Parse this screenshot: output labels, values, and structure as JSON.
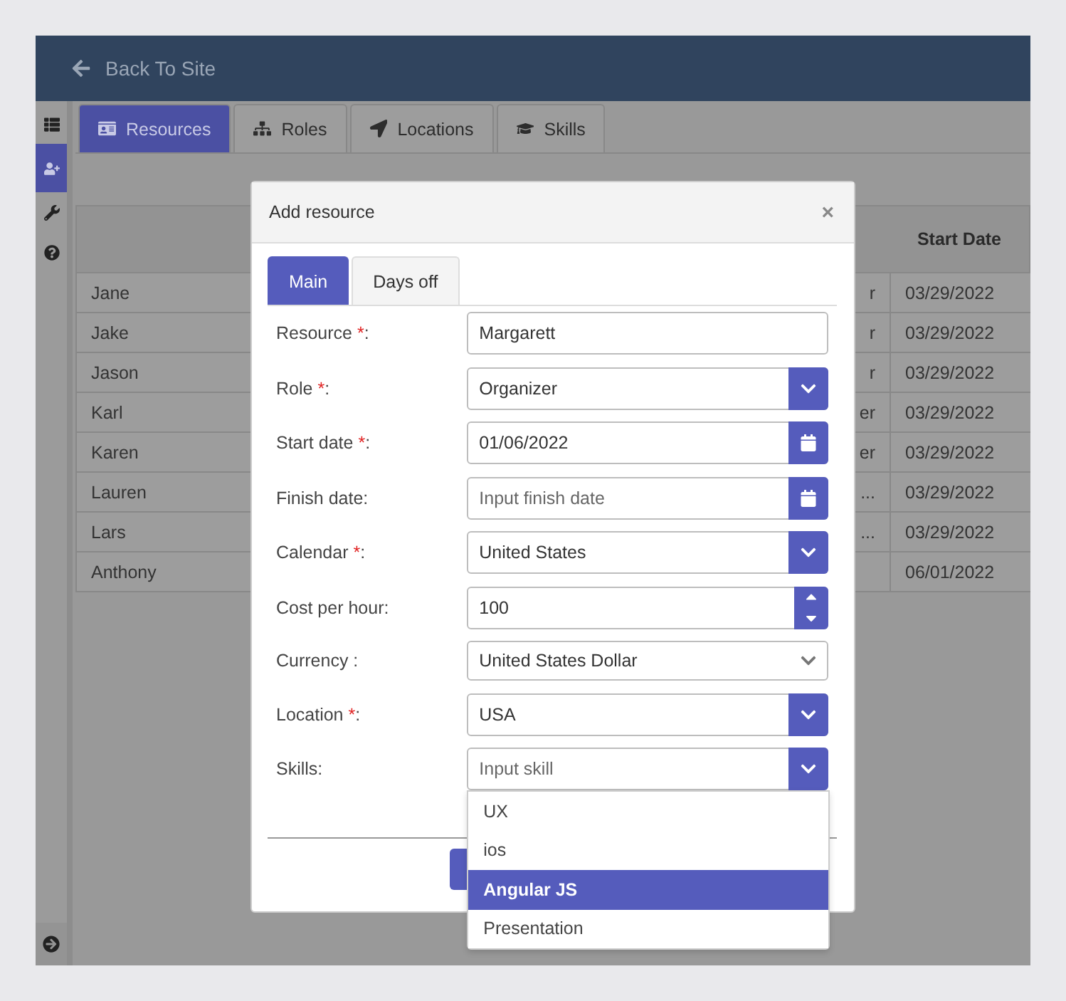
{
  "header": {
    "back_label": "Back To Site"
  },
  "sidebar": {
    "items": [
      {
        "kind": "list",
        "selected": false
      },
      {
        "kind": "user-add",
        "selected": true
      },
      {
        "kind": "wrench",
        "selected": false
      },
      {
        "kind": "help",
        "selected": false
      }
    ]
  },
  "tabs": [
    {
      "label": "Resources",
      "kind": "id-card",
      "selected": true
    },
    {
      "label": "Roles",
      "kind": "sitemap",
      "selected": false
    },
    {
      "label": "Locations",
      "kind": "arrow",
      "selected": false
    },
    {
      "label": "Skills",
      "kind": "cap",
      "selected": false
    }
  ],
  "table": {
    "start_date_heading": "Start Date",
    "rows": [
      {
        "name": "Jane",
        "column_2": "r",
        "start_date": "03/29/2022"
      },
      {
        "name": "Jake",
        "column_2": "r",
        "start_date": "03/29/2022"
      },
      {
        "name": "Jason",
        "column_2": "r",
        "start_date": "03/29/2022"
      },
      {
        "name": "Karl",
        "column_2": "er",
        "start_date": "03/29/2022"
      },
      {
        "name": "Karen",
        "column_2": "er",
        "start_date": "03/29/2022"
      },
      {
        "name": "Lauren",
        "column_2": "...",
        "start_date": "03/29/2022"
      },
      {
        "name": "Lars",
        "column_2": "...",
        "start_date": "03/29/2022"
      },
      {
        "name": "Anthony",
        "start_date": "06/01/2022"
      }
    ]
  },
  "modal": {
    "title": "Add resource",
    "close": "×",
    "tabs": [
      {
        "label": "Main",
        "selected": true
      },
      {
        "label": "Days off",
        "selected": false
      }
    ],
    "fields": [
      {
        "label": "Resource ",
        "required_mark": "*",
        "label_end": ":",
        "kind": "text",
        "value": "Margarett"
      },
      {
        "label": "Role ",
        "required_mark": "*",
        "label_end": ":",
        "kind": "select",
        "value": "Organizer"
      },
      {
        "label": "Start date ",
        "required_mark": "*",
        "label_end": ":",
        "kind": "date",
        "value": "01/06/2022"
      },
      {
        "label": "Finish date:",
        "kind": "date",
        "placeholder": "Input finish date"
      },
      {
        "label": "Calendar ",
        "required_mark": "*",
        "label_end": ":",
        "kind": "select",
        "value": "United States"
      },
      {
        "label": "Cost per hour:",
        "kind": "number",
        "value": "100"
      },
      {
        "label": "Currency :",
        "kind": "plain-select",
        "value": "United States Dollar"
      },
      {
        "label": "Location ",
        "required_mark": "*",
        "label_end": ":",
        "kind": "select",
        "value": "USA"
      },
      {
        "label": "Skills:",
        "kind": "select",
        "placeholder": "Input skill",
        "open": true
      }
    ],
    "dropdown_options": [
      {
        "label": "UX",
        "selected": false
      },
      {
        "label": "ios",
        "selected": false
      },
      {
        "label": "Angular JS",
        "selected": true
      },
      {
        "label": "Presentation",
        "selected": false
      }
    ]
  }
}
